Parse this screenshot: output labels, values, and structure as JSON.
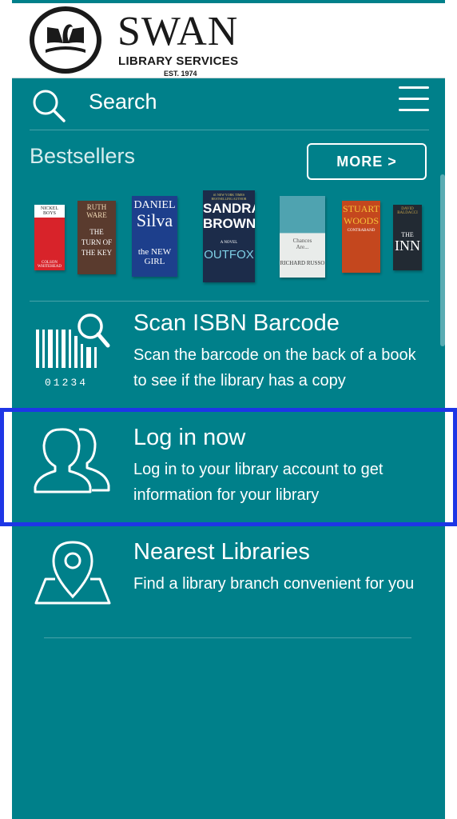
{
  "header": {
    "logo_word": "SWAN",
    "logo_sub": "LIBRARY SERVICES",
    "logo_est": "EST. 1974"
  },
  "search": {
    "label": "Search"
  },
  "bestsellers": {
    "title": "Bestsellers",
    "more_label": "MORE >",
    "books": [
      {
        "cover_text": [
          "NICKEL BOYS",
          "COLSON WHITEHEAD"
        ],
        "color": "#d8232a"
      },
      {
        "cover_text": [
          "RUTH WARE",
          "THE TURN OF THE KEY"
        ],
        "color": "#5a3b2e"
      },
      {
        "cover_text": [
          "DANIEL",
          "Silva",
          "the NEW GIRL"
        ],
        "color": "#1d3f8c"
      },
      {
        "cover_text": [
          "#1 NEW YORK TIMES BESTSELLING AUTHOR",
          "SANDRA",
          "BROWN",
          "A NOVEL",
          "OUTFOX"
        ],
        "color": "#1c2c4a"
      },
      {
        "cover_text": [
          "Chances",
          "Are...",
          "RICHARD RUSSO"
        ],
        "color": "#4fa3b0"
      },
      {
        "cover_text": [
          "STUART",
          "WOODS",
          "CONTRABAND"
        ],
        "color": "#c4471e"
      },
      {
        "cover_text": [
          "DAVID BALDACCI",
          "THE",
          "INN"
        ],
        "color": "#222a33"
      }
    ]
  },
  "features": [
    {
      "title": "Scan ISBN Barcode",
      "desc": "Scan the barcode on the back of a book to see if the library has a copy",
      "icon_label": "01234"
    },
    {
      "title": "Log in now",
      "desc": "Log in to your library account to get information for your library"
    },
    {
      "title": "Nearest Libraries",
      "desc": "Find a library branch convenient for you"
    }
  ],
  "colors": {
    "background": "#00808a",
    "highlight": "#1e36e6",
    "white": "#ffffff"
  }
}
